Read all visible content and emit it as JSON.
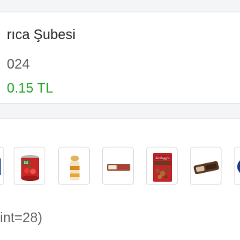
{
  "order": {
    "store_name": "rıca Şubesi",
    "date": "024",
    "total": "0.15 TL"
  },
  "products": {
    "items": [
      {
        "icon": "partial-product-thumbnail"
      },
      {
        "icon": "tomato-paste-can"
      },
      {
        "icon": "bread-loaf-bag"
      },
      {
        "icon": "boxed-pastry"
      },
      {
        "icon": "kelloggs-granola-pack"
      },
      {
        "icon": "chocolate-biscuit-pack"
      },
      {
        "icon": "partial-round-product"
      }
    ],
    "hint": "int=28)"
  },
  "colors": {
    "accent_green": "#2fa52f",
    "card_border": "#dfe1e5",
    "background": "#f4f5f7"
  }
}
